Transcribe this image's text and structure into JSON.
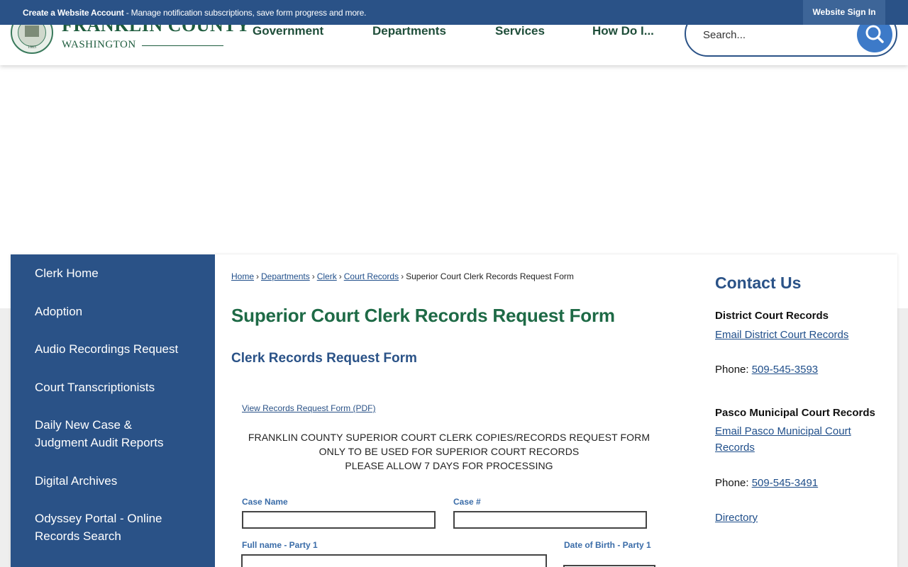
{
  "topbar": {
    "account_link": "Create a Website Account",
    "account_desc": " - Manage notification subscriptions, save form progress and more.",
    "sign_in": "Website Sign In"
  },
  "header": {
    "logo_name": "FRANKLIN COUNTY",
    "logo_state": "WASHINGTON",
    "seal_year": "1883",
    "nav": [
      "Government",
      "Departments",
      "Services",
      "How Do I..."
    ],
    "search_placeholder": "Search...",
    "search_icon": "search-icon"
  },
  "sidebar": {
    "items": [
      "Clerk Home",
      "Adoption",
      "Audio Recordings Request",
      "Court Transcriptionists",
      "Daily New Case & Judgment Audit Reports",
      "Digital Archives",
      "Odyssey Portal - Online Records Search"
    ]
  },
  "breadcrumb": {
    "links": [
      "Home",
      "Departments",
      "Clerk",
      "Court Records"
    ],
    "current": "Superior Court Clerk Records Request Form",
    "separator": "›"
  },
  "main": {
    "title": "Superior Court Clerk Records Request Form",
    "subtitle": "Clerk Records Request Form",
    "pdf_link": "View Records Request Form (PDF)",
    "notice_lines": [
      "FRANKLIN COUNTY SUPERIOR COURT CLERK COPIES/RECORDS REQUEST FORM",
      "ONLY TO BE USED FOR SUPERIOR COURT RECORDS",
      "PLEASE ALLOW 7 DAYS FOR PROCESSING"
    ],
    "form": {
      "case_name_label": "Case Name",
      "case_number_label": "Case #",
      "full_name_label": "Full name - Party 1",
      "dob_label": "Date of Birth - Party 1"
    }
  },
  "contact": {
    "heading": "Contact Us",
    "district": {
      "name": "District Court Records",
      "email": "Email District Court Records",
      "phone_label": "Phone: ",
      "phone": "509-545-3593"
    },
    "pasco": {
      "name": "Pasco Municipal Court Records",
      "email": "Email Pasco Municipal Court Records",
      "phone_label": "Phone: ",
      "phone": "509-545-3491"
    },
    "directory": "Directory"
  },
  "colors": {
    "brand_blue": "#2a5287",
    "brand_green": "#1e6a46",
    "link_blue": "#1f4e8a"
  }
}
